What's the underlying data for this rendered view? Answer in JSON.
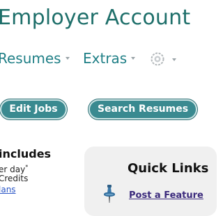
{
  "header": {
    "title": "Employer Account"
  },
  "nav": {
    "items": [
      {
        "label": "Resumes",
        "icon": "chevron-down-icon"
      },
      {
        "label": "Extras",
        "icon": "chevron-down-icon"
      }
    ],
    "settings_icon": "gear-icon"
  },
  "actions": {
    "edit_jobs_label": "Edit Jobs",
    "search_resumes_label": "Search Resumes"
  },
  "plan": {
    "title": "includes",
    "line1": "er day",
    "line1_mark": "*",
    "line2": "Credits",
    "link": "lans"
  },
  "quick_links": {
    "title": "Quick Links",
    "post_featured": "Post a Feature"
  },
  "colors": {
    "title": "#1e6f6a",
    "nav": "#1f7f86",
    "button": "#3a8a90",
    "link": "#2a56c6",
    "quick_link": "#3b2a7c"
  }
}
